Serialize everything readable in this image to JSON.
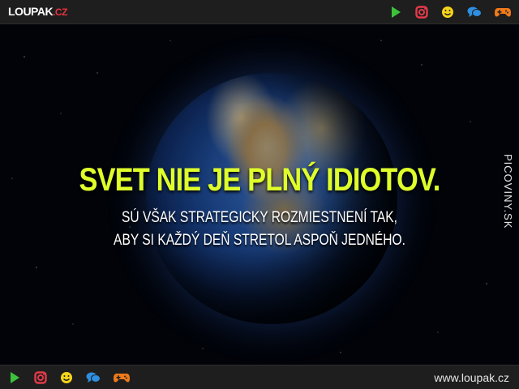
{
  "header": {
    "logo_main": "LOUPAK",
    "logo_tld": ".CZ",
    "icons": [
      "play-icon",
      "instagram-icon",
      "smiley-icon",
      "chat-icon",
      "gamepad-icon"
    ]
  },
  "image": {
    "headline": "SVET NIE JE PLNÝ IDIOTOV.",
    "subline1": "SÚ VŠAK STRATEGICKY ROZMIESTNENÍ TAK,",
    "subline2": "ABY SI KAŽDÝ DEŇ STRETOL ASPOŇ JEDNÉHO.",
    "watermark": "PICOVINY.SK",
    "headline_color": "#dfff2a"
  },
  "footer": {
    "url": "www.loupak.cz",
    "icons": [
      "play-icon",
      "instagram-icon",
      "smiley-icon",
      "chat-icon",
      "gamepad-icon"
    ]
  },
  "colors": {
    "bar_bg": "#1e1e1e",
    "play": "#3cc13b",
    "instagram": "#e23a4a",
    "smiley": "#f5d51b",
    "chat": "#2f8ee0",
    "gamepad": "#f07a1a"
  }
}
